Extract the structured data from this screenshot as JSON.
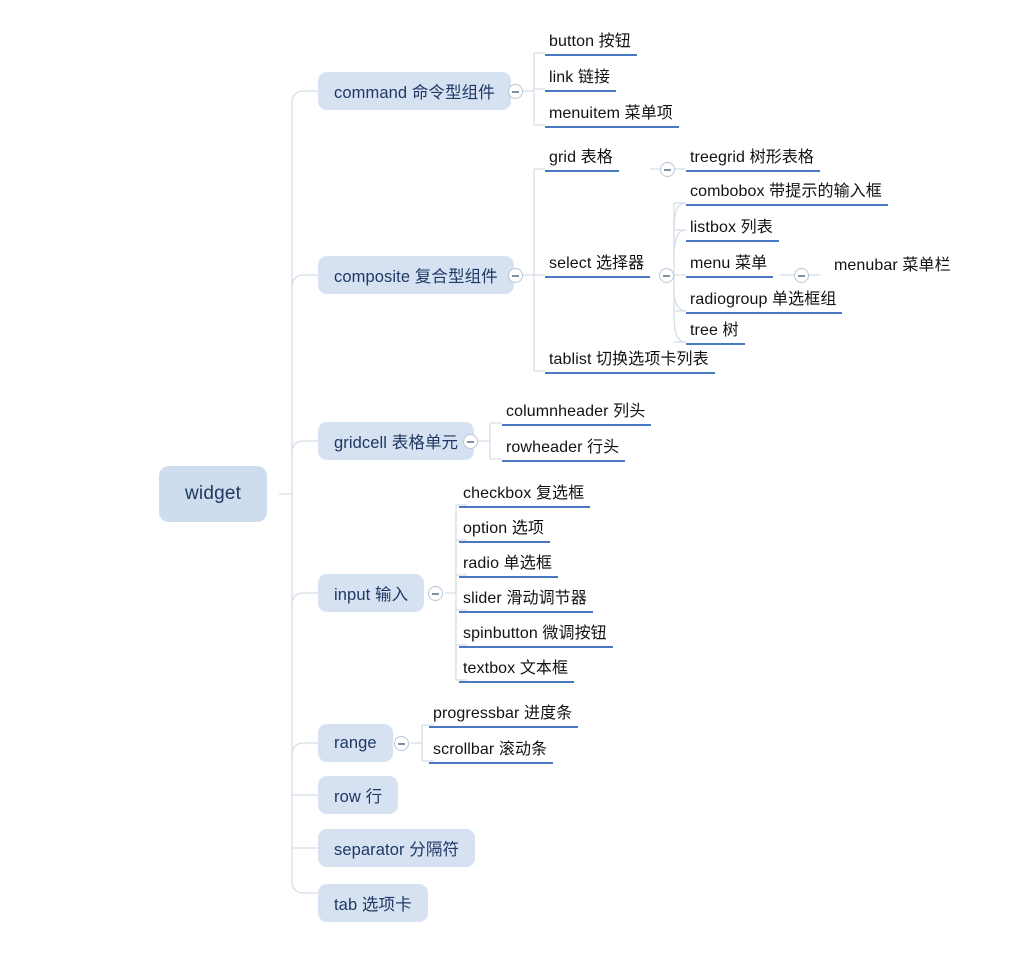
{
  "diagram": {
    "kind": "mindmap",
    "title": "widget",
    "background": "#ffffff",
    "colors": {
      "root_fill": "#cedded",
      "branch_fill": "#d6e2f2",
      "node_text": "#1f3864",
      "leaf_text": "#121212",
      "leaf_underline": "#4a79c4",
      "connector": "#d7dee8",
      "toggle_border": "#b9c6d8",
      "toggle_glyph": "#7f8fa6"
    },
    "toggle_icon": "collapse-minus-circle-icon"
  },
  "root": {
    "label": "widget"
  },
  "branches": [
    {
      "id": "command",
      "label": "command 命令型组件",
      "collapsible": true,
      "children": [
        {
          "id": "button",
          "label": "button 按钮"
        },
        {
          "id": "link",
          "label": "link 链接"
        },
        {
          "id": "menuitem",
          "label": "menuitem 菜单项"
        }
      ]
    },
    {
      "id": "composite",
      "label": "composite 复合型组件",
      "collapsible": true,
      "children": [
        {
          "id": "grid",
          "label": "grid 表格",
          "collapsible": true,
          "children": [
            {
              "id": "treegrid",
              "label": "treegrid 树形表格"
            }
          ]
        },
        {
          "id": "select",
          "label": "select 选择器",
          "collapsible": true,
          "children": [
            {
              "id": "combobox",
              "label": "combobox 带提示的输入框"
            },
            {
              "id": "listbox",
              "label": "listbox 列表"
            },
            {
              "id": "menu",
              "label": "menu 菜单",
              "collapsible": true,
              "children": [
                {
                  "id": "menubar",
                  "label": "menubar 菜单栏",
                  "underline": false
                }
              ]
            },
            {
              "id": "radiogroup",
              "label": "radiogroup 单选框组"
            },
            {
              "id": "tree",
              "label": "tree 树"
            }
          ]
        },
        {
          "id": "tablist",
          "label": "tablist 切换选项卡列表"
        }
      ]
    },
    {
      "id": "gridcell",
      "label": "gridcell 表格单元",
      "collapsible": true,
      "children": [
        {
          "id": "columnheader",
          "label": "columnheader 列头"
        },
        {
          "id": "rowheader",
          "label": "rowheader 行头"
        }
      ]
    },
    {
      "id": "input",
      "label": "input 输入",
      "collapsible": true,
      "children": [
        {
          "id": "checkbox",
          "label": "checkbox 复选框"
        },
        {
          "id": "option",
          "label": "option 选项"
        },
        {
          "id": "radio",
          "label": "radio 单选框"
        },
        {
          "id": "slider",
          "label": "slider 滑动调节器"
        },
        {
          "id": "spinbutton",
          "label": "spinbutton 微调按钮"
        },
        {
          "id": "textbox",
          "label": "textbox 文本框"
        }
      ]
    },
    {
      "id": "range",
      "label": "range",
      "collapsible": true,
      "children": [
        {
          "id": "progressbar",
          "label": "progressbar 进度条"
        },
        {
          "id": "scrollbar",
          "label": "scrollbar 滚动条"
        }
      ]
    },
    {
      "id": "row",
      "label": "row 行",
      "children": []
    },
    {
      "id": "separator",
      "label": "separator 分隔符",
      "children": []
    },
    {
      "id": "tab",
      "label": "tab 选项卡",
      "children": []
    }
  ]
}
